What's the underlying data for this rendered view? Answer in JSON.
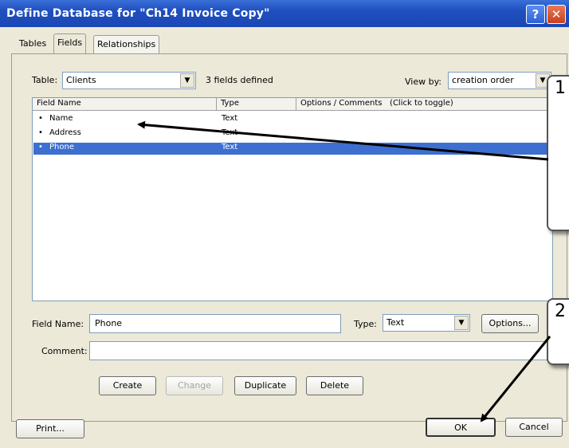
{
  "window": {
    "title": "Define Database for \"Ch14 Invoice Copy\"",
    "help_glyph": "?",
    "close_glyph": "✕"
  },
  "tabs": [
    {
      "label": "Tables"
    },
    {
      "label": "Fields"
    },
    {
      "label": "Relationships"
    }
  ],
  "table_selector": {
    "label": "Table:",
    "value": "Clients",
    "count_text": "3 fields defined"
  },
  "view_by": {
    "label": "View by:",
    "value": "creation order"
  },
  "field_list": {
    "headers": [
      "Field Name",
      "Type",
      "Options / Comments   (Click to toggle)"
    ],
    "rows": [
      {
        "bullet": "•",
        "name": "Name",
        "type": "Text"
      },
      {
        "bullet": "•",
        "name": "Address",
        "type": "Text"
      },
      {
        "bullet": "•",
        "name": "Phone",
        "type": "Text"
      }
    ],
    "selected_index": 2
  },
  "field_name": {
    "label": "Field Name:",
    "value": "Phone"
  },
  "type_select": {
    "label": "Type:",
    "value": "Text"
  },
  "options_button": "Options...",
  "comment": {
    "label": "Comment:",
    "value": ""
  },
  "actions": {
    "create": "Create",
    "change": "Change",
    "duplicate": "Duplicate",
    "delete": "Delete"
  },
  "footer": {
    "print": "Print...",
    "ok": "OK",
    "cancel": "Cancel"
  },
  "callouts": [
    {
      "number": "1"
    },
    {
      "number": "2"
    }
  ]
}
